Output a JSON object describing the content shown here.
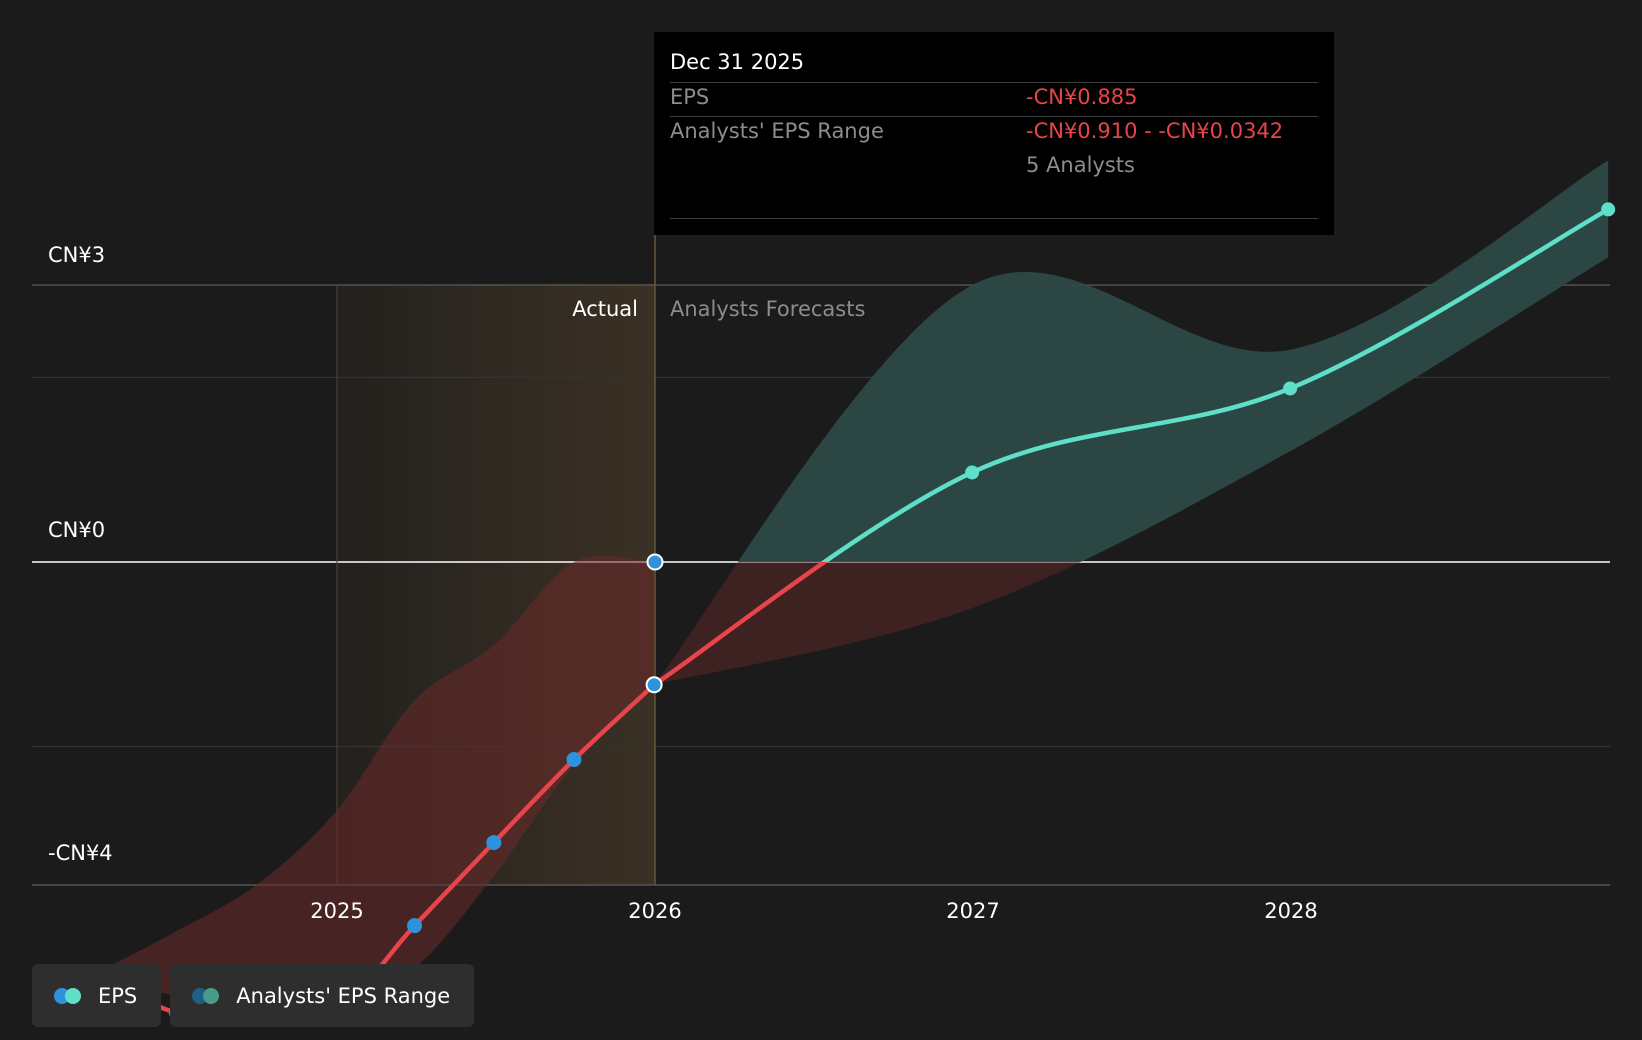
{
  "chart_data": {
    "type": "line",
    "x_ticks": [
      "2025",
      "2026",
      "2027",
      "2028"
    ],
    "y_ticks": [
      "CN¥3",
      "CN¥0",
      "-CN¥4"
    ],
    "section_labels": {
      "actual": "Actual",
      "forecast": "Analysts Forecasts"
    },
    "series": [
      {
        "name": "EPS",
        "actual": [
          {
            "x": "2024-03-31",
            "y": -4.45
          },
          {
            "x": "2024-06-30",
            "y": -4.88
          },
          {
            "x": "2024-09-30",
            "y": -4.83
          },
          {
            "x": "2024-12-31",
            "y": -4.85
          },
          {
            "x": "2025-03-31",
            "y": -3.94
          },
          {
            "x": "2025-06-30",
            "y": -3.04
          },
          {
            "x": "2025-09-30",
            "y": -2.14
          },
          {
            "x": "2025-12-31",
            "y": -1.33
          }
        ],
        "forecast": [
          {
            "x": "2025-12-31",
            "y": -1.33
          },
          {
            "x": "2026-12-31",
            "y": 0.97
          },
          {
            "x": "2027-12-31",
            "y": 1.88
          },
          {
            "x": "2028-12-31",
            "y": 3.82
          }
        ]
      },
      {
        "name": "Analysts' EPS Range",
        "actual_low": [
          -4.45,
          -4.7,
          -4.75,
          -4.78,
          -4.4,
          -3.4,
          -2.2,
          -1.33
        ],
        "actual_high": [
          -4.45,
          -4.0,
          -3.5,
          -2.7,
          -1.5,
          -0.9,
          0.0,
          0.0
        ],
        "forecast_low": [
          {
            "x": "2025-12-31",
            "y": -1.33
          },
          {
            "x": "2026-12-31",
            "y": -0.5
          },
          {
            "x": "2027-12-31",
            "y": 1.2
          },
          {
            "x": "2028-12-31",
            "y": 3.3
          }
        ],
        "forecast_high": [
          {
            "x": "2025-12-31",
            "y": -1.33
          },
          {
            "x": "2026-12-31",
            "y": 3.0
          },
          {
            "x": "2027-12-31",
            "y": 2.3
          },
          {
            "x": "2028-12-31",
            "y": 4.35
          }
        ]
      }
    ],
    "tooltip": {
      "date": "Dec 31 2025",
      "eps_label": "EPS",
      "eps_value": "-CN¥0.885",
      "range_label": "Analysts' EPS Range",
      "range_value": "-CN¥0.910 - -CN¥0.0342",
      "analysts": "5 Analysts"
    },
    "colors": {
      "actual_line": "#e8454a",
      "forecast_line": "#5ee0c8",
      "actual_point": "#2e93dc",
      "forecast_range": "#2d4a46",
      "negative_range": "#6b2a2a",
      "actual_band": "#3a3024"
    }
  },
  "legend": {
    "eps": "EPS",
    "range": "Analysts' EPS Range"
  }
}
